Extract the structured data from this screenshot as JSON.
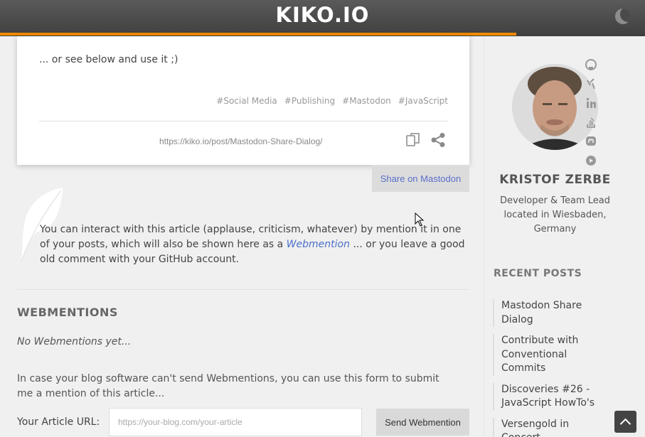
{
  "header": {
    "brand": "KIKO.IO",
    "progress": 0.8
  },
  "card": {
    "text": "... or see below and use it ;)",
    "tags": [
      "#Social Media",
      "#Publishing",
      "#Mastodon",
      "#JavaScript"
    ],
    "share_url": "https://kiko.io/post/Mastodon-Share-Dialog/"
  },
  "mastodon_button": "Share on Mastodon",
  "interaction": {
    "text_before": "You can interact with this article (applause, criticism, whatever) by mention it in one of your posts, which will also be shown here as a ",
    "link": "Webmention",
    "text_after": " ... or you leave a good old comment with your GitHub account."
  },
  "webmentions": {
    "title": "WEBMENTIONS",
    "empty": "No Webmentions yet...",
    "info": "In case your blog software can't send Webmentions, you can use this form to submit me a mention of this article...",
    "url_label": "Your Article URL:",
    "url_placeholder": "https://your-blog.com/your-article",
    "send_button": "Send Webmention"
  },
  "sidebar": {
    "name": "KRISTOF ZERBE",
    "bio": "Developer & Team Lead located in Wiesbaden, Germany",
    "social_icons": [
      "github-icon",
      "xing-icon",
      "linkedin-icon",
      "stackoverflow-icon",
      "mastodon-icon",
      "youtube-icon"
    ],
    "recent_title": "RECENT POSTS",
    "recent_posts": [
      "Mastodon Share Dialog",
      "Contribute with Conventional Commits",
      "Discoveries #26 - JavaScript HowTo's",
      "Versengold in Concert"
    ]
  },
  "icons": {
    "theme_toggle": "moon-icon",
    "copy": "copy-icon",
    "share": "share-icon",
    "feather": "feather-icon",
    "scroll_top": "chevron-up-icon"
  }
}
